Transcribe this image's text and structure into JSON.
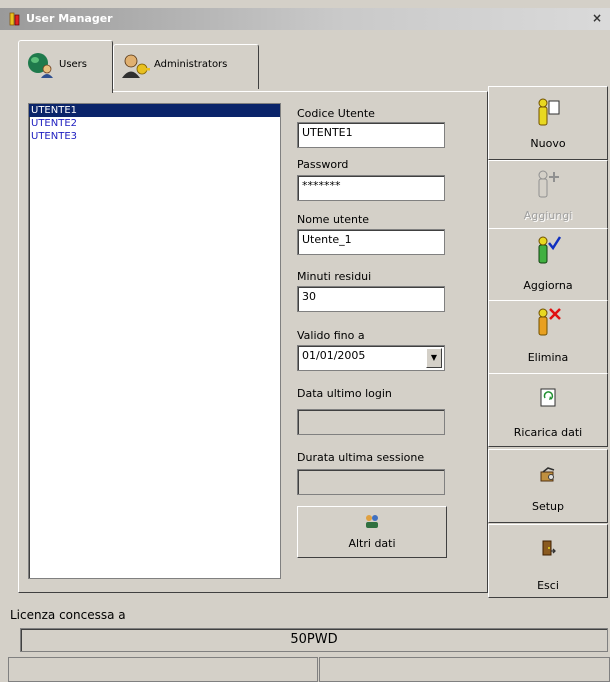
{
  "window": {
    "title": "User Manager",
    "close_label": "×"
  },
  "tabs": [
    {
      "label": "Users",
      "icon": "users-icon"
    },
    {
      "label": "Administrators",
      "icon": "administrators-icon"
    }
  ],
  "user_list": {
    "items": [
      "UTENTE1",
      "UTENTE2",
      "UTENTE3"
    ],
    "selected": "UTENTE1"
  },
  "form": {
    "codice_utente": {
      "label": "Codice Utente",
      "value": "UTENTE1"
    },
    "password": {
      "label": "Password",
      "value": "*******"
    },
    "nome_utente": {
      "label": "Nome utente",
      "value": "Utente_1"
    },
    "minuti_residui": {
      "label": "Minuti residui",
      "value": "30"
    },
    "valido_fino_a": {
      "label": "Valido fino a",
      "value": "01/01/2005"
    },
    "data_ultimo_login": {
      "label": "Data ultimo login",
      "value": ""
    },
    "durata_ultima_sessione": {
      "label": "Durata ultima sessione",
      "value": ""
    },
    "altri_dati_label": "Altri dati"
  },
  "toolbar": {
    "nuovo": "Nuovo",
    "aggiungi": "Aggiungi",
    "aggiorna": "Aggiorna",
    "elimina": "Elimina",
    "ricarica": "Ricarica dati",
    "setup": "Setup",
    "esci": "Esci"
  },
  "license": {
    "label": "Licenza concessa a",
    "value": "50PWD"
  },
  "colors": {
    "selection": "#0a246a",
    "list_text": "#2020c0",
    "face": "#d4d0c8",
    "delete_mark": "#e01010",
    "check_mark": "#1030c0"
  }
}
